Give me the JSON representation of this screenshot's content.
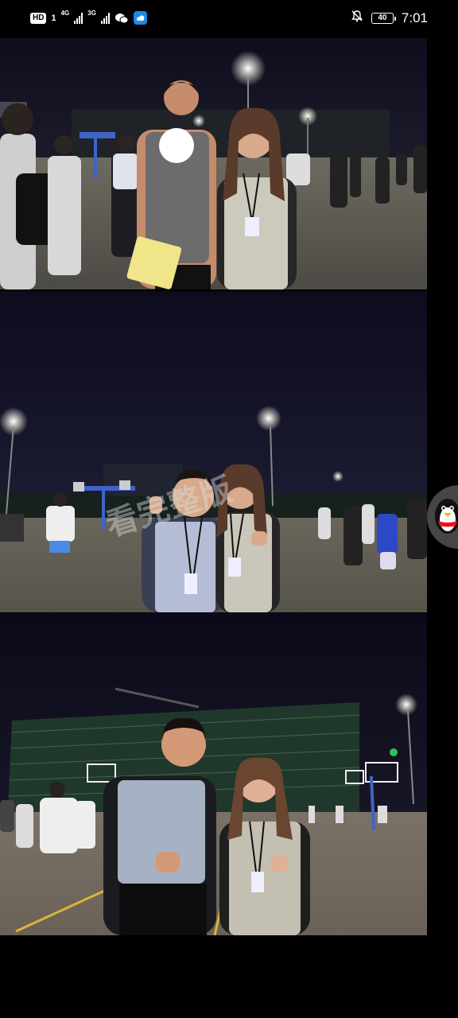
{
  "status_bar": {
    "hd_label": "HD",
    "sim1": "1",
    "net1": "4G",
    "net2": "3G",
    "battery": "40",
    "time": "7:01",
    "icons": [
      "wechat-icon",
      "app-icon",
      "bell-muted-icon"
    ]
  },
  "watermark": {
    "text": "看完整版"
  },
  "photos": [
    "night-court-photo-1",
    "night-court-photo-2",
    "night-court-photo-3"
  ]
}
